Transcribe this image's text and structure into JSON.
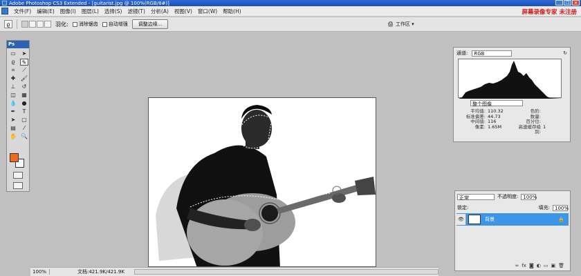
{
  "window": {
    "title": "Adobe Photoshop CS3 Extended - [guitarist.jpg @ 100%(RGB/8#)]",
    "controls": [
      "_",
      "❐",
      "✕"
    ]
  },
  "menu": {
    "items": [
      "文件(F)",
      "编辑(E)",
      "图像(I)",
      "图层(L)",
      "选择(S)",
      "滤镜(T)",
      "分析(A)",
      "视图(V)",
      "窗口(W)",
      "帮助(H)"
    ],
    "promo": "屏幕录像专家 未注册"
  },
  "options": {
    "feather_label": "羽化:",
    "refine_label": "调整边缘...",
    "check1": "消除锯齿",
    "check2": "自动增强",
    "workspace_label": "工作区 ▾"
  },
  "histogram": {
    "channel_label": "通道:",
    "channel_value": "RGB",
    "source_value": "整个图像",
    "rows": [
      {
        "k": "平均值:",
        "v": "110.32",
        "k2": "色阶:",
        "v2": ""
      },
      {
        "k": "标准偏差:",
        "v": "44.73",
        "k2": "数量:",
        "v2": ""
      },
      {
        "k": "中间值:",
        "v": "116",
        "k2": "百分位:",
        "v2": ""
      },
      {
        "k": "像素:",
        "v": "1.65M",
        "k2": "高速缓存级别:",
        "v2": "1"
      }
    ]
  },
  "layers": {
    "blend_mode": "正常",
    "opacity_label": "不透明度:",
    "opacity": "100%",
    "fill_label": "填充:",
    "fill": "100%",
    "lock_label": "锁定:",
    "layer_name": "背景",
    "lock_icon": "🔒"
  },
  "status": {
    "zoom": "100%",
    "doc": "文档:421.9K/421.9K"
  },
  "colors": {
    "foreground": "#f06a1e",
    "background": "#ffffff"
  }
}
